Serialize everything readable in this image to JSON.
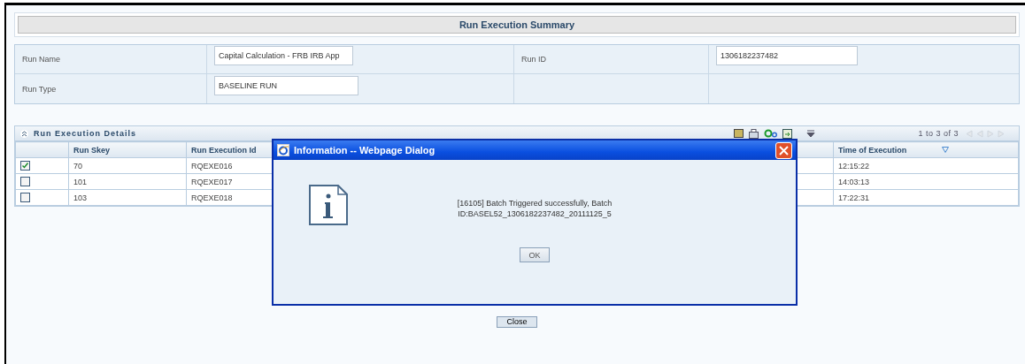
{
  "summary": {
    "title": "Run Execution Summary",
    "fields": [
      {
        "label": "Run Name",
        "value": "Capital Calculation - FRB IRB App"
      },
      {
        "label": "Run ID",
        "value": "1306182237482"
      },
      {
        "label": "Run Type",
        "value": "BASELINE RUN"
      }
    ]
  },
  "details": {
    "title": "Run Execution Details",
    "pagination": "1 to 3 of 3",
    "columns": [
      "Run Skey",
      "Run Execution Id",
      "Time of Execution"
    ],
    "rows": [
      {
        "checked": true,
        "cells": [
          "70",
          "RQEXE016",
          "12:15:22"
        ]
      },
      {
        "checked": false,
        "cells": [
          "101",
          "RQEXE017",
          "14:03:13"
        ]
      },
      {
        "checked": false,
        "cells": [
          "103",
          "RQEXE018",
          "17:22:31"
        ]
      }
    ]
  },
  "close_button": "Close",
  "dialog": {
    "title": "Information -- Webpage Dialog",
    "message": "[16105] Batch Triggered successfully, Batch ID:BASEL52_1306182237482_20111125_5",
    "ok": "OK"
  }
}
